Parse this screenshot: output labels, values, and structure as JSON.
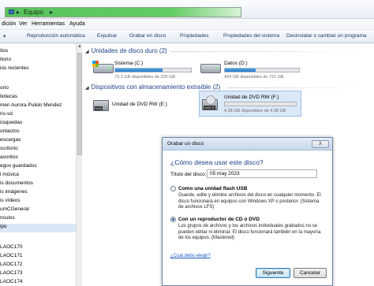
{
  "window": {
    "breadcrumb": "Equipo"
  },
  "menu": {
    "items": [
      "dición",
      "Ver",
      "Herramientas",
      "Ayuda"
    ]
  },
  "toolbar": {
    "items": [
      "Reproducción automática",
      "Expulsar",
      "Grabar en disco",
      "Propiedades",
      "Propiedades del sistema",
      "Desinstalar o cambiar un programa"
    ]
  },
  "nav": {
    "items": [
      "itos",
      "itorio",
      "ios recientes",
      "orio",
      "liotecas",
      "men Aurora Pulido Mendez",
      "ris-sd",
      "úsquedas",
      "ontactos",
      "escargas",
      "scritorio",
      "avoritos",
      "egos guardados",
      "i música",
      "is documentos",
      "is imágenes",
      "is vídeos",
      "umCGeneral",
      "nculos",
      "ipo",
      "LAOC170",
      "LAOC171",
      "LAOC172",
      "LAOC173",
      "LAOC174"
    ],
    "selected_index": 19
  },
  "content": {
    "hdd_group": "Unidades de disco duro (2)",
    "removable_group": "Dispositivos con almacenamiento extraíble (2)",
    "drives": [
      {
        "name": "Sistema (C:)",
        "free": "73,3 GB disponibles de 200 GB",
        "used_fraction": 0.63
      },
      {
        "name": "Datos (D:)",
        "free": "424 GB disponibles de 731 GB",
        "used_fraction": 0.42
      }
    ],
    "removable": [
      {
        "name": "Unidad de DVD RW (E:)"
      },
      {
        "name": "Unidad de DVD RW (F:)",
        "free": "4,38 GB disponibles de 4,38 GB",
        "used_fraction": 0.0,
        "media_label": "DVD-R"
      }
    ]
  },
  "dialog": {
    "title": "Grabar un disco",
    "close": "X",
    "question": "¿Cómo desea usar este disco?",
    "disc_title_label": "Título del disco:",
    "disc_title_value": "05 may 2023",
    "option_usb": {
      "title": "Como una unidad flash USB",
      "desc": "Guarde, edite y elimine archivos del disco en cualquier momento. El disco funcionará en equipos con Windows XP o posterior. (Sistema de archivos LFS)",
      "selected": false
    },
    "option_cd": {
      "title": "Con un reproductor de CD o DVD",
      "desc": "Los grupos de archivos y los archivos individuales grabados no se pueden editar ni eliminar. El disco funcionará también en la mayoría de los equipos. (Mastered)",
      "selected": true
    },
    "help_link": "¿Cuál debo elegir?",
    "next_button": "Siguiente",
    "cancel_button": "Cancelar"
  },
  "colors": {
    "address_green": "#59c25b",
    "group_header": "#1e3f8a",
    "capacity_bar": "#2c7bc8"
  }
}
